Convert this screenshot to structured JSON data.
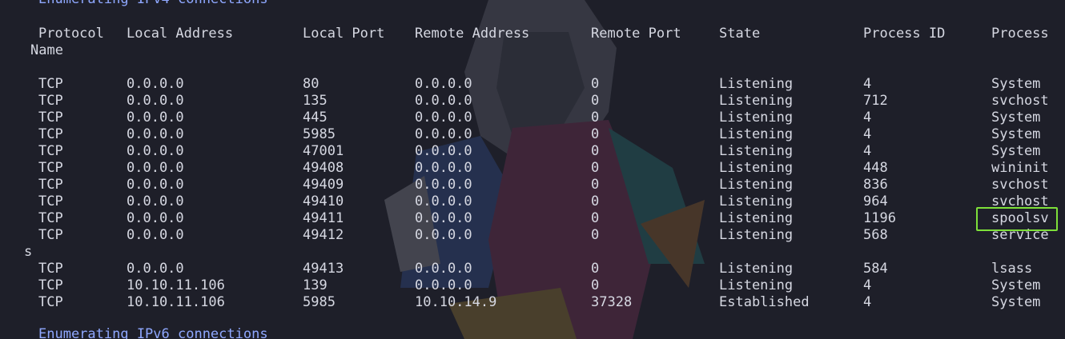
{
  "window": {
    "background": "#1e1f29",
    "text_color": "#d6d8e2",
    "section_color": "#8fa8ff",
    "highlight_color": "#7ee03a"
  },
  "sections": {
    "ipv4": "Enumerating IPv4 connections",
    "ipv6": "Enumerating IPv6 connections"
  },
  "table": {
    "headers": [
      "Protocol",
      "Local Address",
      "Local Port",
      "Remote Address",
      "Remote Port",
      "State",
      "Process ID",
      "Process"
    ],
    "header_wrap": "Name",
    "rows": [
      {
        "protocol": "TCP",
        "local_address": "0.0.0.0",
        "local_port": "80",
        "remote_address": "0.0.0.0",
        "remote_port": "0",
        "state": "Listening",
        "pid": "4",
        "process": "System"
      },
      {
        "protocol": "TCP",
        "local_address": "0.0.0.0",
        "local_port": "135",
        "remote_address": "0.0.0.0",
        "remote_port": "0",
        "state": "Listening",
        "pid": "712",
        "process": "svchost"
      },
      {
        "protocol": "TCP",
        "local_address": "0.0.0.0",
        "local_port": "445",
        "remote_address": "0.0.0.0",
        "remote_port": "0",
        "state": "Listening",
        "pid": "4",
        "process": "System"
      },
      {
        "protocol": "TCP",
        "local_address": "0.0.0.0",
        "local_port": "5985",
        "remote_address": "0.0.0.0",
        "remote_port": "0",
        "state": "Listening",
        "pid": "4",
        "process": "System"
      },
      {
        "protocol": "TCP",
        "local_address": "0.0.0.0",
        "local_port": "47001",
        "remote_address": "0.0.0.0",
        "remote_port": "0",
        "state": "Listening",
        "pid": "4",
        "process": "System"
      },
      {
        "protocol": "TCP",
        "local_address": "0.0.0.0",
        "local_port": "49408",
        "remote_address": "0.0.0.0",
        "remote_port": "0",
        "state": "Listening",
        "pid": "448",
        "process": "wininit"
      },
      {
        "protocol": "TCP",
        "local_address": "0.0.0.0",
        "local_port": "49409",
        "remote_address": "0.0.0.0",
        "remote_port": "0",
        "state": "Listening",
        "pid": "836",
        "process": "svchost"
      },
      {
        "protocol": "TCP",
        "local_address": "0.0.0.0",
        "local_port": "49410",
        "remote_address": "0.0.0.0",
        "remote_port": "0",
        "state": "Listening",
        "pid": "964",
        "process": "svchost"
      },
      {
        "protocol": "TCP",
        "local_address": "0.0.0.0",
        "local_port": "49411",
        "remote_address": "0.0.0.0",
        "remote_port": "0",
        "state": "Listening",
        "pid": "1196",
        "process": "spoolsv",
        "highlighted": true
      },
      {
        "protocol": "TCP",
        "local_address": "0.0.0.0",
        "local_port": "49412",
        "remote_address": "0.0.0.0",
        "remote_port": "0",
        "state": "Listening",
        "pid": "568",
        "process": "service",
        "process_wrap": "s"
      },
      {
        "protocol": "TCP",
        "local_address": "0.0.0.0",
        "local_port": "49413",
        "remote_address": "0.0.0.0",
        "remote_port": "0",
        "state": "Listening",
        "pid": "584",
        "process": "lsass"
      },
      {
        "protocol": "TCP",
        "local_address": "10.10.11.106",
        "local_port": "139",
        "remote_address": "0.0.0.0",
        "remote_port": "0",
        "state": "Listening",
        "pid": "4",
        "process": "System"
      },
      {
        "protocol": "TCP",
        "local_address": "10.10.11.106",
        "local_port": "5985",
        "remote_address": "10.10.14.9",
        "remote_port": "37328",
        "state": "Established",
        "pid": "4",
        "process": "System"
      }
    ]
  }
}
